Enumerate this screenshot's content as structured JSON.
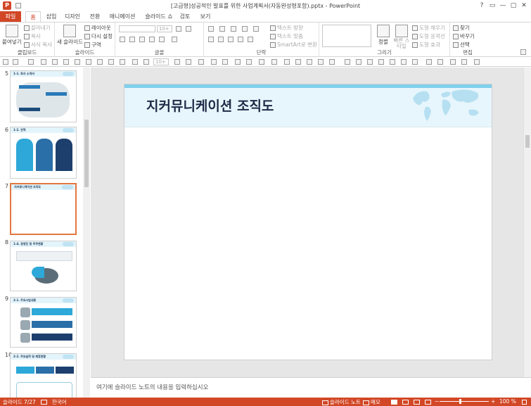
{
  "window": {
    "title": "[고급형]성공적인 발표를 위한 사업계획서(자동완성형포함).pptx - PowerPoint",
    "controls": [
      "?",
      "▭",
      "—",
      "▢",
      "✕"
    ]
  },
  "tabs": [
    {
      "label": "파일"
    },
    {
      "label": "홈"
    },
    {
      "label": "삽입"
    },
    {
      "label": "디자인"
    },
    {
      "label": "전환"
    },
    {
      "label": "애니메이션"
    },
    {
      "label": "슬라이드 쇼"
    },
    {
      "label": "검토"
    },
    {
      "label": "보기"
    }
  ],
  "ribbon": {
    "clipboard": {
      "label": "클립보드",
      "paste": "붙여넣기",
      "cut": "잘라내기",
      "copy": "복사",
      "format": "서식 복사"
    },
    "slides": {
      "label": "슬라이드",
      "new": "새 슬라이드",
      "layout": "레이아웃",
      "reset": "다시 설정",
      "section": "구역"
    },
    "font": {
      "label": "글꼴",
      "size": "10+"
    },
    "paragraph": {
      "label": "단락",
      "text_dir": "텍스트 방향",
      "align_text": "텍스트 맞춤",
      "smartart": "SmartArt로 변환"
    },
    "drawing": {
      "label": "그리기",
      "arrange": "정렬",
      "quick_styles": "빠른 스타일",
      "fill": "도형 채우기",
      "outline": "도형 윤곽선",
      "effects": "도형 효과"
    },
    "editing": {
      "label": "편집",
      "find": "찾기",
      "replace": "바꾸기",
      "select": "선택"
    }
  },
  "qat": {
    "font_size": "10+"
  },
  "slides": [
    {
      "num": "5",
      "title": "1-1. 회사 소개서"
    },
    {
      "num": "6",
      "title": "1-2. 연혁"
    },
    {
      "num": "7",
      "title": "지커뮤니케이션 조직도"
    },
    {
      "num": "8",
      "title": "1-4. 경영진 및 주주현황"
    },
    {
      "num": "9",
      "title": "2-1. 주요사업내용"
    },
    {
      "num": "10",
      "title": "2-2. 주요실적 및 제휴현황"
    }
  ],
  "current_slide": {
    "title": "지커뮤니케이션 조직도"
  },
  "notes_placeholder": "여기에 슬라이드 노트의 내용을 입력하십시오",
  "status": {
    "slide_pos": "슬라이드 7/27",
    "language": "한국어",
    "notes": "슬라이드 노트",
    "comments": "메모",
    "zoom": "100 %"
  },
  "colors": {
    "accent": "#d24726",
    "slide_band": "#7fd0ec",
    "slide_header_bg": "#e7f6fc",
    "title": "#1e2a46"
  }
}
